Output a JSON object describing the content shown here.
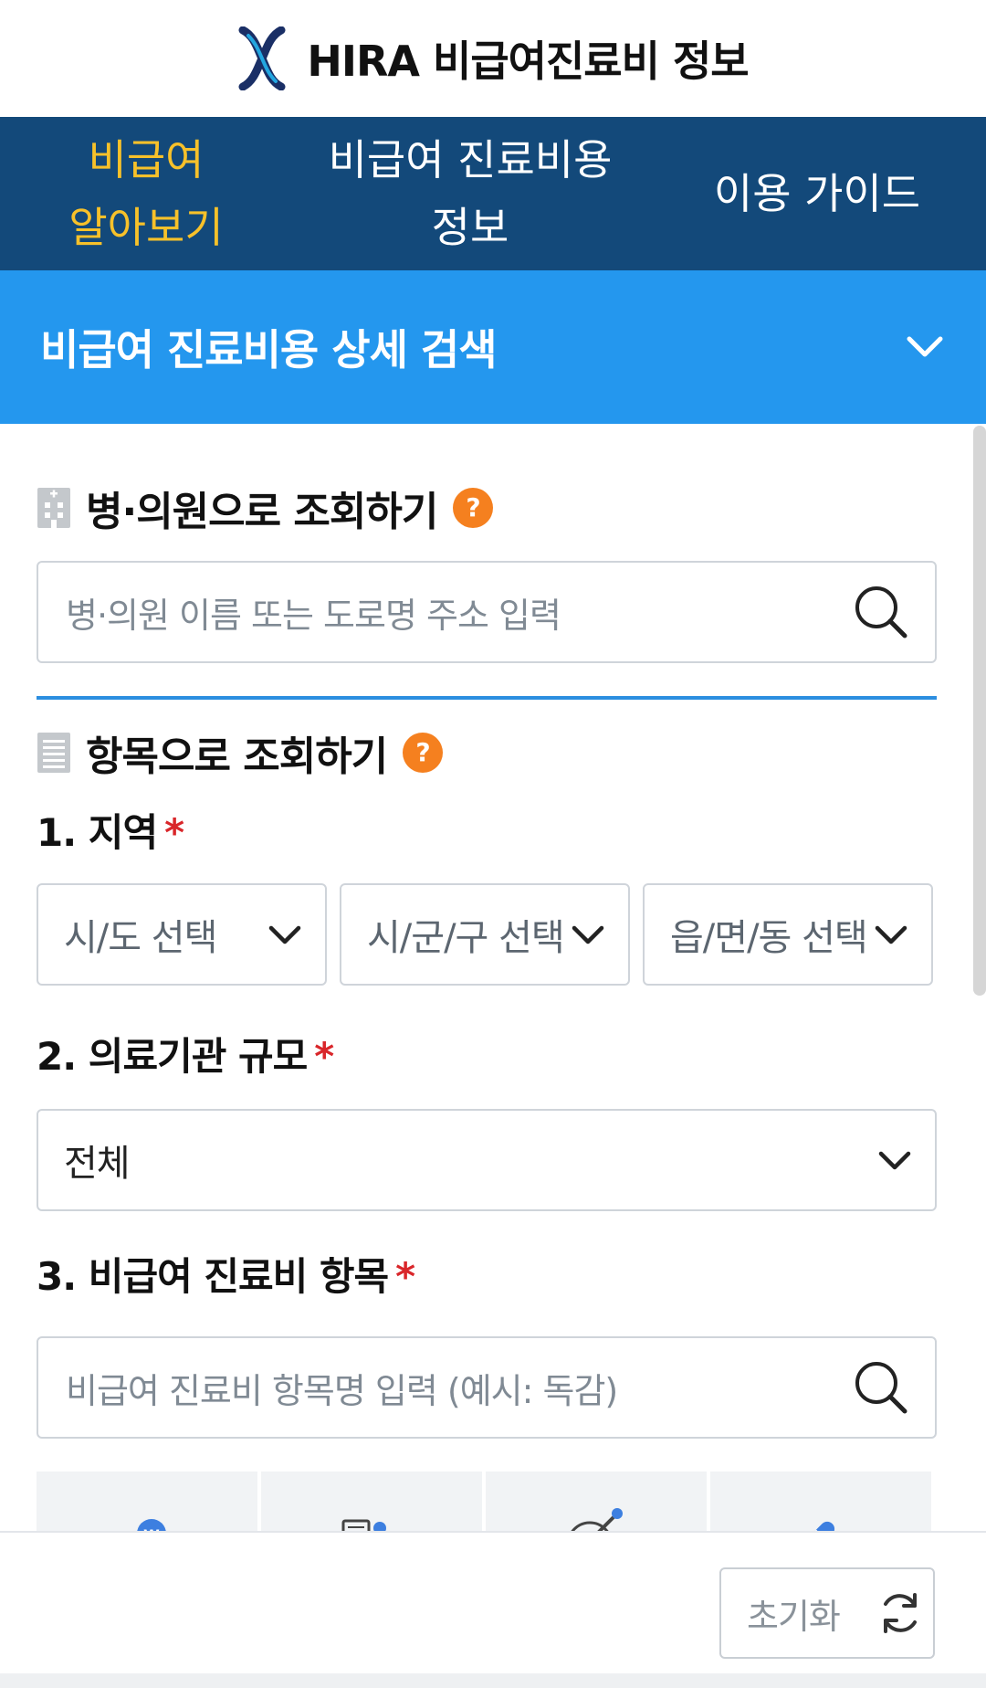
{
  "header": {
    "title": "HIRA 비급여진료비 정보",
    "logo_icon": "hira-logo"
  },
  "nav": {
    "items": [
      {
        "line1": "비급여",
        "line2": "알아보기",
        "active": true
      },
      {
        "line1": "비급여 진료비용",
        "line2": "정보",
        "active": false
      },
      {
        "line1": "이용 가이드",
        "line2": "",
        "active": false
      }
    ],
    "active_color": "#f7c12a",
    "background": "#13497a"
  },
  "section": {
    "title": "비급여 진료비용 상세 검색",
    "background": "#2497ee"
  },
  "hospital_search": {
    "heading": "병·의원으로 조회하기",
    "placeholder": "병·의원 이름 또는 도로명 주소 입력"
  },
  "item_search": {
    "heading": "항목으로 조회하기",
    "region": {
      "label": "1. 지역",
      "required": "*",
      "selects": [
        "시/도 선택",
        "시/군/구 선택",
        "읍/면/동 선택"
      ]
    },
    "facility": {
      "label": "2. 의료기관 규모",
      "required": "*",
      "selected": "전체"
    },
    "item": {
      "label": "3. 비급여 진료비 항목",
      "required": "*",
      "placeholder": "비급여 진료비 항목명 입력 (예시: 독감)"
    },
    "category_icons": [
      "category-w-icon",
      "category-consult-icon",
      "category-injection-icon",
      "category-pill-icon"
    ]
  },
  "footer": {
    "reset_label": "초기화"
  }
}
